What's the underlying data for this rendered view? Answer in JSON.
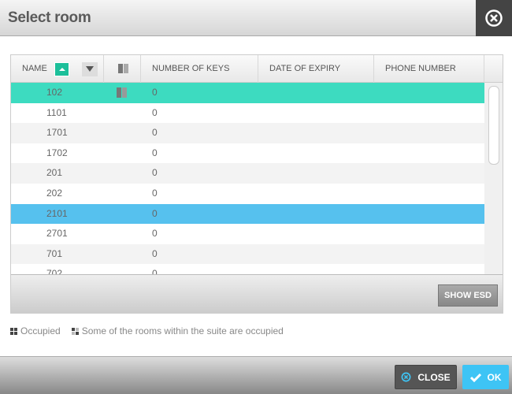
{
  "title": "Select room",
  "colors": {
    "selected_green": "#3ddbc0",
    "selected_blue": "#56c1ee",
    "ok": "#3ec4f5"
  },
  "columns": [
    "NAME",
    "NUMBER OF KEYS",
    "DATE OF EXPIRY",
    "PHONE NUMBER"
  ],
  "rows": [
    {
      "name": "102",
      "keys": "0",
      "occupied_icon": true,
      "state": "selected-green"
    },
    {
      "name": "1101",
      "keys": "0"
    },
    {
      "name": "1701",
      "keys": "0"
    },
    {
      "name": "1702",
      "keys": "0"
    },
    {
      "name": "201",
      "keys": "0"
    },
    {
      "name": "202",
      "keys": "0"
    },
    {
      "name": "2101",
      "keys": "0",
      "state": "selected-blue"
    },
    {
      "name": "2701",
      "keys": "0"
    },
    {
      "name": "701",
      "keys": "0"
    },
    {
      "name": "702",
      "keys": "0"
    }
  ],
  "show_esd": "SHOW ESD",
  "legend": {
    "occupied": "Occupied",
    "partial": "Some of the rooms within the suite are occupied"
  },
  "buttons": {
    "close": "CLOSE",
    "ok": "OK"
  }
}
